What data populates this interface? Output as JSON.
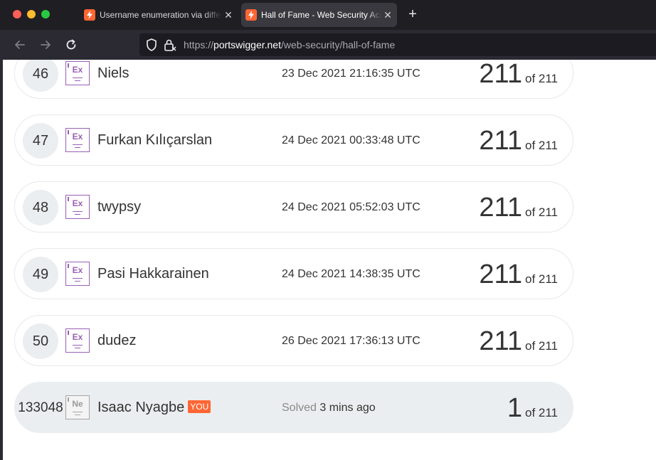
{
  "browser": {
    "tabs": [
      {
        "title": "Username enumeration via different responses",
        "close": "✕",
        "active": false
      },
      {
        "title": "Hall of Fame - Web Security Academy",
        "close": "✕",
        "active": true
      }
    ],
    "new_tab": "+",
    "url": {
      "prefix": "https://",
      "host": "portswigger.net",
      "path": "/web-security/hall-of-fame"
    }
  },
  "hall_of_fame": {
    "rows": [
      {
        "rank": "46",
        "badge": "Ex",
        "name": "Niels",
        "date": "23 Dec 2021 21:16:35 UTC",
        "score": "211",
        "of": "of 211"
      },
      {
        "rank": "47",
        "badge": "Ex",
        "name": "Furkan Kılıçarslan",
        "date": "24 Dec 2021 00:33:48 UTC",
        "score": "211",
        "of": "of 211"
      },
      {
        "rank": "48",
        "badge": "Ex",
        "name": "twypsy",
        "date": "24 Dec 2021 05:52:03 UTC",
        "score": "211",
        "of": "of 211"
      },
      {
        "rank": "49",
        "badge": "Ex",
        "name": "Pasi Hakkarainen",
        "date": "24 Dec 2021 14:38:35 UTC",
        "score": "211",
        "of": "of 211"
      },
      {
        "rank": "50",
        "badge": "Ex",
        "name": "dudez",
        "date": "26 Dec 2021 17:36:13 UTC",
        "score": "211",
        "of": "of 211"
      }
    ],
    "current_user": {
      "rank": "133048",
      "badge": "Ne",
      "name": "Isaac Nyagbe",
      "you_label": "YOU",
      "solved_label": "Solved",
      "solved_time": "3 mins ago",
      "score": "1",
      "of": "of 211"
    }
  },
  "colors": {
    "accent": "#ff6633",
    "expert_badge": "#9a5fb5",
    "row_highlight": "#ebeef0"
  }
}
